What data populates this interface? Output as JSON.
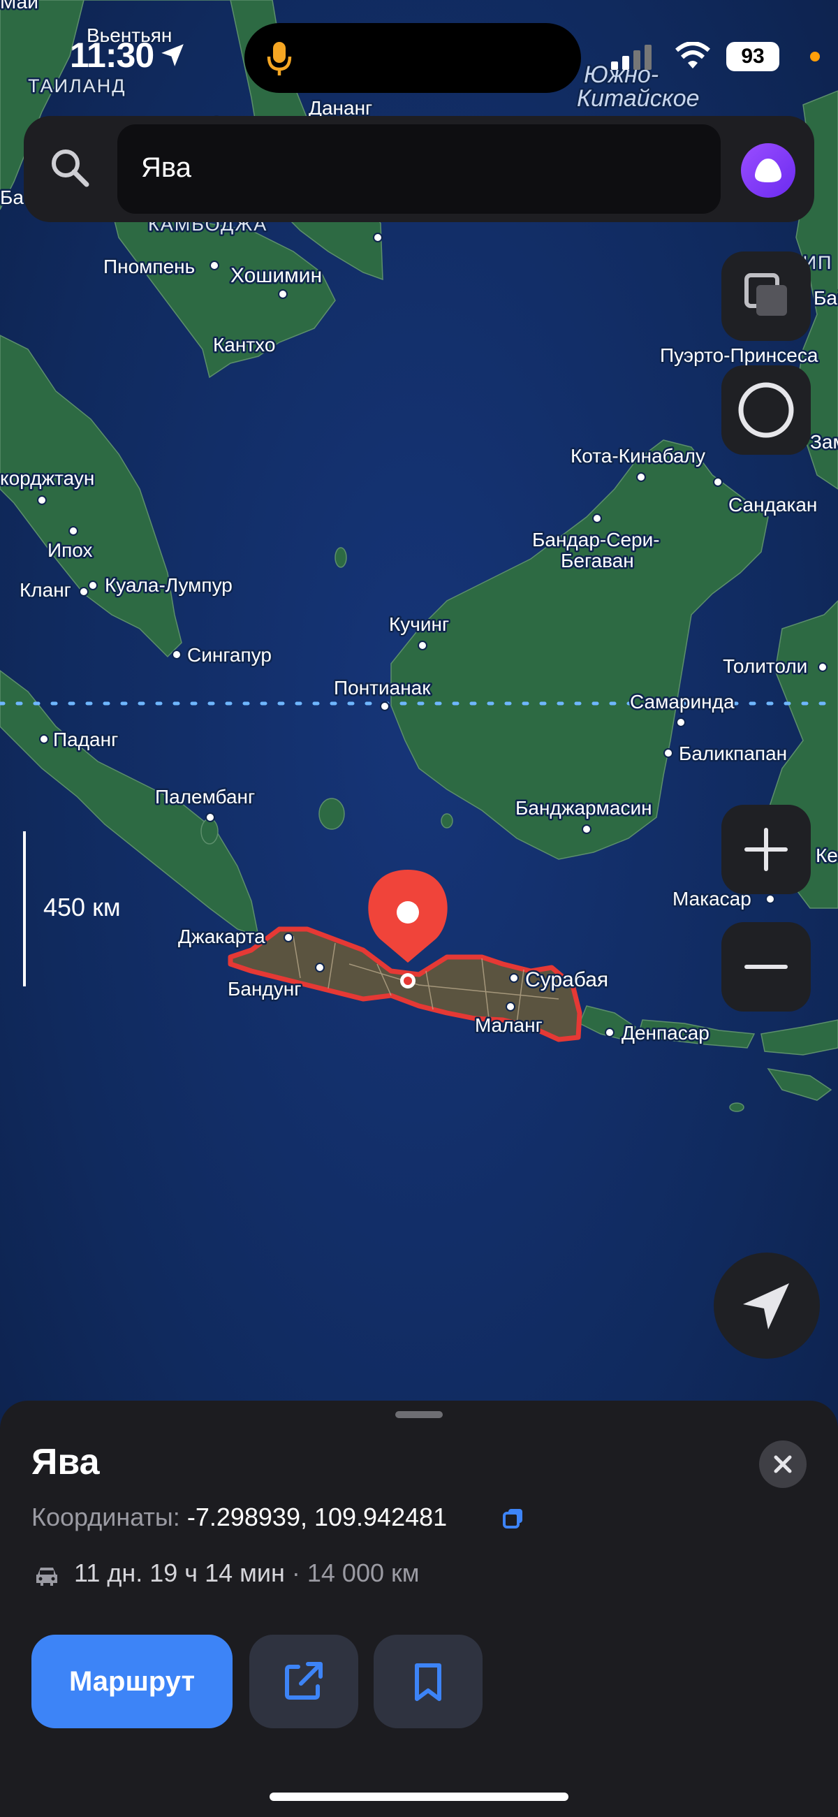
{
  "status_bar": {
    "time": "11:30",
    "battery": "93",
    "icons": [
      "location-arrow-icon",
      "microphone-icon",
      "signal-icon",
      "wifi-icon",
      "battery-icon"
    ]
  },
  "search": {
    "value": "Ява",
    "icons": [
      "search-icon",
      "alice-assistant-icon"
    ]
  },
  "map": {
    "sea_labels": [
      "Южно-",
      "Китайское"
    ],
    "country_labels": [
      "ТАИЛАНД",
      "КАМБОДЖА",
      "ФИЛИП"
    ],
    "cities": {
      "vientiane": "Вьентьян",
      "mai": "Май",
      "danang": "Дананг",
      "phnompenh": "Пномпень",
      "hochiminh": "Хошимин",
      "canttho": "Кантхо",
      "puerto": "Пуэрто-Принсеса",
      "kota": "Кота-Кинабалу",
      "sandakan": "Сандакан",
      "georgetown": "корджтаун",
      "ipoh": "Ипох",
      "klang": "Кланг",
      "kl": "Куала-Лумпур",
      "bandar1": "Бандар-Сери-",
      "bandar2": "Бегаван",
      "kuching": "Кучинг",
      "singapore": "Сингапур",
      "tolitoli": "Толитоли",
      "pontianak": "Понтианак",
      "samarinda": "Самаринда",
      "padang": "Паданг",
      "balikpapan": "Баликпапан",
      "palembang": "Палембанг",
      "banjarmasin": "Банджармасин",
      "kend": "Кенд",
      "makassar": "Макасар",
      "jakarta": "Джакарта",
      "bandung": "Бандунг",
      "surabaya": "Сурабая",
      "malang": "Маланг",
      "denpasar": "Денпасар",
      "ba": "Ба",
      "bai": "Бай",
      "zamb": "Замбоан",
      "sa": "Ба"
    },
    "scale_label": "450 км",
    "controls": [
      "layers-icon",
      "alice-sphere-icon",
      "zoom-in-icon",
      "zoom-out-icon",
      "navigation-arrow-icon"
    ]
  },
  "place_card": {
    "title": "Ява",
    "coords_label": "Координаты:",
    "coords_value": "-7.298939, 109.942481",
    "route_time": "11 дн. 19 ч 14 мин",
    "route_separator": "·",
    "route_distance": "14 000 км",
    "route_button": "Маршрут",
    "icons": [
      "close-icon",
      "copy-icon",
      "car-icon",
      "share-icon",
      "bookmark-icon"
    ]
  },
  "colors": {
    "sea": "#12295a",
    "land": "#2e6a42",
    "highlight": "#e53935",
    "accent_blue": "#3d84f7",
    "alice_purple": "#7b39f5"
  }
}
